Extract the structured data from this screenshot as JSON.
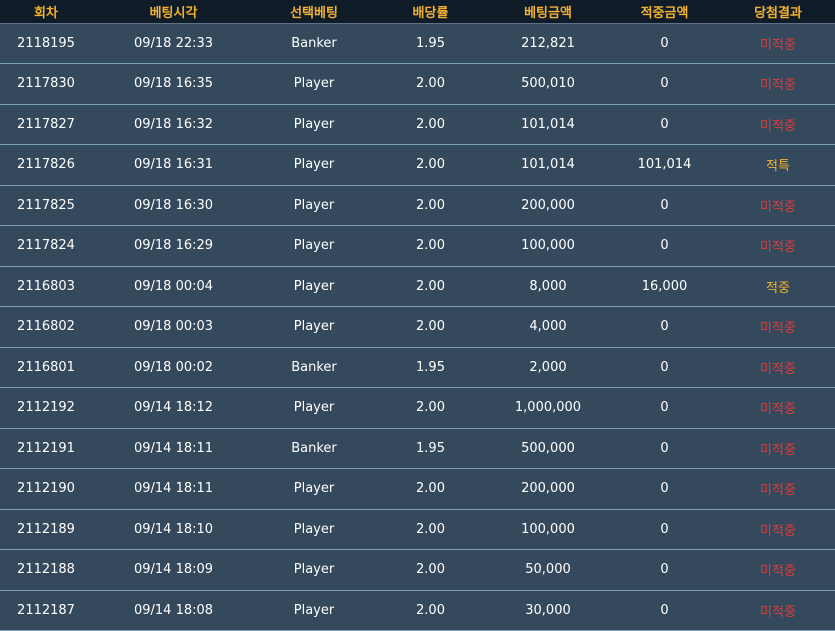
{
  "table": {
    "headers": [
      "회차",
      "베팅시각",
      "선택베팅",
      "배당률",
      "베팅금액",
      "적중금액",
      "당첨결과"
    ],
    "rows": [
      {
        "round": "2118195",
        "time": "09/18 22:33",
        "choice": "Banker",
        "odds": "1.95",
        "bet": "212,821",
        "win": "0",
        "result": "미적중",
        "status": "miss"
      },
      {
        "round": "2117830",
        "time": "09/18 16:35",
        "choice": "Player",
        "odds": "2.00",
        "bet": "500,010",
        "win": "0",
        "result": "미적중",
        "status": "miss"
      },
      {
        "round": "2117827",
        "time": "09/18 16:32",
        "choice": "Player",
        "odds": "2.00",
        "bet": "101,014",
        "win": "0",
        "result": "미적중",
        "status": "miss"
      },
      {
        "round": "2117826",
        "time": "09/18 16:31",
        "choice": "Player",
        "odds": "2.00",
        "bet": "101,014",
        "win": "101,014",
        "result": "적특",
        "status": "hit"
      },
      {
        "round": "2117825",
        "time": "09/18 16:30",
        "choice": "Player",
        "odds": "2.00",
        "bet": "200,000",
        "win": "0",
        "result": "미적중",
        "status": "miss"
      },
      {
        "round": "2117824",
        "time": "09/18 16:29",
        "choice": "Player",
        "odds": "2.00",
        "bet": "100,000",
        "win": "0",
        "result": "미적중",
        "status": "miss"
      },
      {
        "round": "2116803",
        "time": "09/18 00:04",
        "choice": "Player",
        "odds": "2.00",
        "bet": "8,000",
        "win": "16,000",
        "result": "적중",
        "status": "hit"
      },
      {
        "round": "2116802",
        "time": "09/18 00:03",
        "choice": "Player",
        "odds": "2.00",
        "bet": "4,000",
        "win": "0",
        "result": "미적중",
        "status": "miss"
      },
      {
        "round": "2116801",
        "time": "09/18 00:02",
        "choice": "Banker",
        "odds": "1.95",
        "bet": "2,000",
        "win": "0",
        "result": "미적중",
        "status": "miss"
      },
      {
        "round": "2112192",
        "time": "09/14 18:12",
        "choice": "Player",
        "odds": "2.00",
        "bet": "1,000,000",
        "win": "0",
        "result": "미적중",
        "status": "miss"
      },
      {
        "round": "2112191",
        "time": "09/14 18:11",
        "choice": "Banker",
        "odds": "1.95",
        "bet": "500,000",
        "win": "0",
        "result": "미적중",
        "status": "miss"
      },
      {
        "round": "2112190",
        "time": "09/14 18:11",
        "choice": "Player",
        "odds": "2.00",
        "bet": "200,000",
        "win": "0",
        "result": "미적중",
        "status": "miss"
      },
      {
        "round": "2112189",
        "time": "09/14 18:10",
        "choice": "Player",
        "odds": "2.00",
        "bet": "100,000",
        "win": "0",
        "result": "미적중",
        "status": "miss"
      },
      {
        "round": "2112188",
        "time": "09/14 18:09",
        "choice": "Player",
        "odds": "2.00",
        "bet": "50,000",
        "win": "0",
        "result": "미적중",
        "status": "miss"
      },
      {
        "round": "2112187",
        "time": "09/14 18:08",
        "choice": "Player",
        "odds": "2.00",
        "bet": "30,000",
        "win": "0",
        "result": "미적중",
        "status": "miss"
      }
    ]
  },
  "colors": {
    "header_bg": "#0f1c28",
    "header_text": "#f3b12f",
    "row_bg": "#34495c",
    "row_border": "#7fa0b9",
    "miss_text": "#e33a3a",
    "hit_text": "#f3b12f"
  }
}
